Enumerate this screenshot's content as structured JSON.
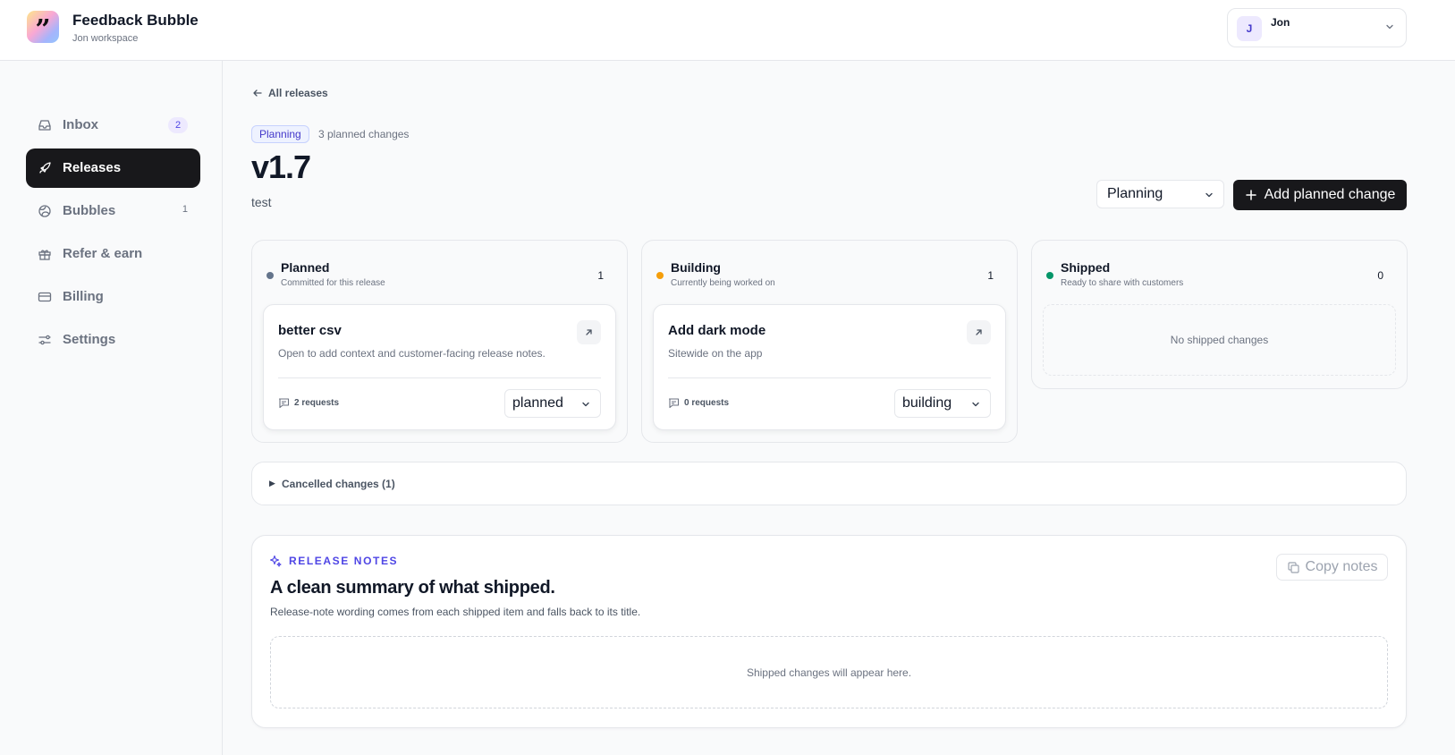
{
  "app": {
    "name": "Feedback Bubble",
    "workspace": "Jon workspace",
    "logo_glyph": "”"
  },
  "user": {
    "initial": "J",
    "name": "Jon"
  },
  "sidebar": {
    "items": [
      {
        "label": "Inbox",
        "icon": "inbox-icon",
        "badge": "2"
      },
      {
        "label": "Releases",
        "icon": "rocket-icon",
        "active": true
      },
      {
        "label": "Bubbles",
        "icon": "globe-icon",
        "count": "1"
      },
      {
        "label": "Refer & earn",
        "icon": "gift-icon"
      },
      {
        "label": "Billing",
        "icon": "credit-card-icon"
      },
      {
        "label": "Settings",
        "icon": "sliders-icon"
      }
    ]
  },
  "release": {
    "back_label": "All releases",
    "status_pill": "Planning",
    "planned_count": "3 planned changes",
    "title": "v1.7",
    "description": "test",
    "status_value": "Planning",
    "add_button": "Add planned change"
  },
  "columns": [
    {
      "title": "Planned",
      "subtitle": "Committed for this release",
      "count": "1",
      "dot_color": "#64748b",
      "card": {
        "title": "better csv",
        "desc": "Open to add context and customer-facing release notes.",
        "requests": "2 requests",
        "status": "planned"
      }
    },
    {
      "title": "Building",
      "subtitle": "Currently being worked on",
      "count": "1",
      "dot_color": "#f59e0b",
      "card": {
        "title": "Add dark mode",
        "desc": "Sitewide on the app",
        "requests": "0 requests",
        "status": "building"
      }
    },
    {
      "title": "Shipped",
      "subtitle": "Ready to share with customers",
      "count": "0",
      "dot_color": "#059669",
      "empty": "No shipped changes"
    }
  ],
  "cancelled": {
    "label": "Cancelled changes (1)"
  },
  "notes": {
    "eyebrow": "RELEASE NOTES",
    "heading": "A clean summary of what shipped.",
    "sub": "Release-note wording comes from each shipped item and falls back to its title.",
    "copy_label": "Copy notes",
    "empty": "Shipped changes will appear here."
  },
  "colors": {
    "accent": "#4f46e5",
    "dark": "#18181b",
    "border": "#e5e7eb",
    "muted": "#6b7280"
  }
}
